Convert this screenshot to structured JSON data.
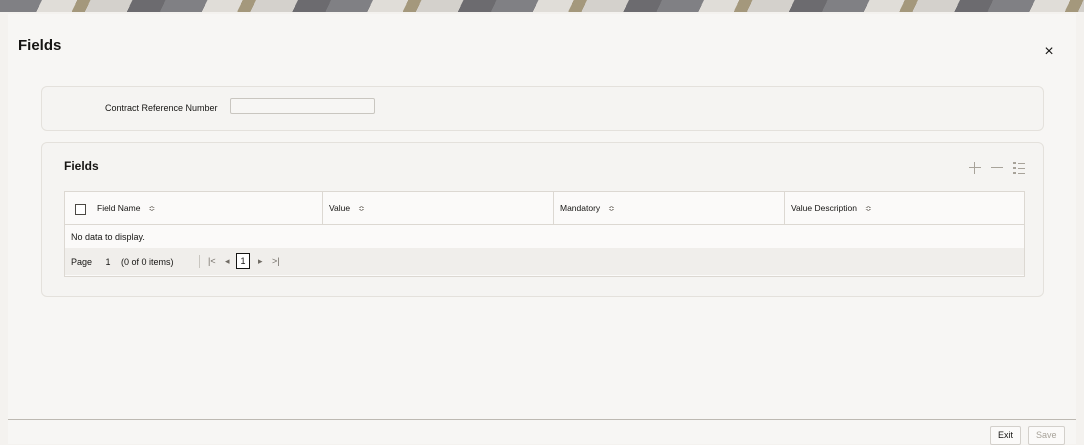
{
  "window": {
    "title": "Fields",
    "close_glyph": "×"
  },
  "header": {
    "contract_ref_label": "Contract Reference Number",
    "contract_ref_value": ""
  },
  "fields_section": {
    "title": "Fields",
    "toolbar": {
      "add_icon": "plus-icon",
      "remove_icon": "minus-icon",
      "view_icon": "list-icon"
    },
    "columns": [
      "Field Name",
      "Value",
      "Mandatory",
      "Value Description"
    ],
    "sort_glyph": "≎",
    "empty_text": "No data to display.",
    "pagination": {
      "page_label": "Page",
      "page_value": "1",
      "count_text": "(0 of 0 items)",
      "first_glyph": "|<",
      "prev_glyph": "◂",
      "current_page": "1",
      "next_glyph": "▸",
      "last_glyph": ">|"
    }
  },
  "footer": {
    "exit_label": "Exit",
    "save_label": "Save"
  }
}
